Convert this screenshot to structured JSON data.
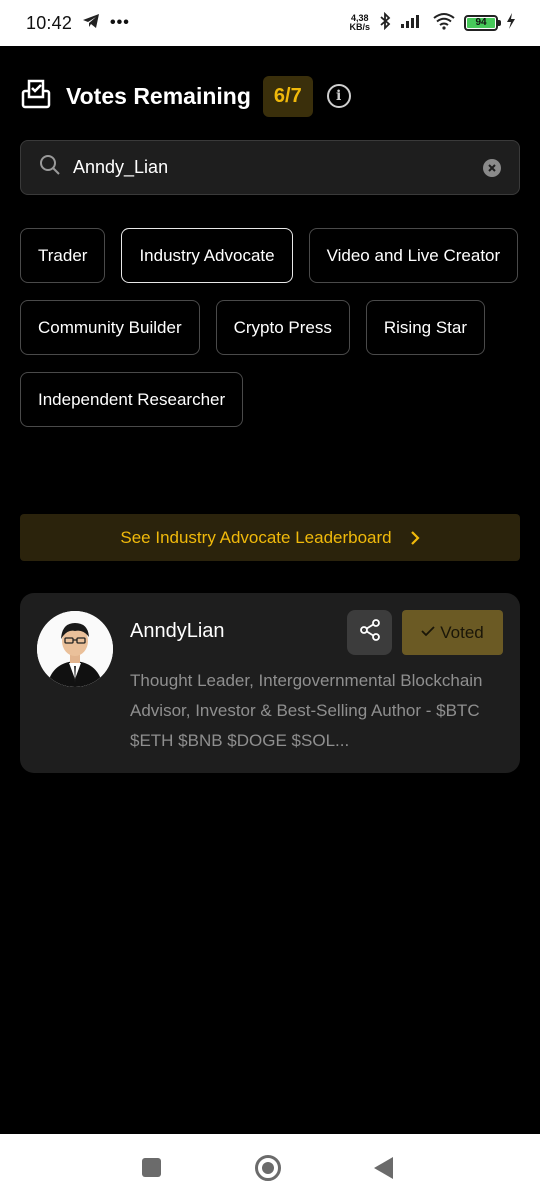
{
  "status_bar": {
    "time": "10:42",
    "network_speed_value": "4,38",
    "network_speed_unit": "KB/s",
    "battery": "94"
  },
  "header": {
    "title": "Votes Remaining",
    "votes_badge": "6/7"
  },
  "search": {
    "value": "Anndy_Lian"
  },
  "categories": [
    "Trader",
    "Industry Advocate",
    "Video and Live Creator",
    "Community Builder",
    "Crypto Press",
    "Rising Star",
    "Independent Researcher"
  ],
  "selected_category": "Industry Advocate",
  "leaderboard_link": "See Industry Advocate Leaderboard",
  "result_card": {
    "name": "AnndyLian",
    "voted_label": "Voted",
    "description": "Thought Leader, Intergovernmental Blockchain Advisor, Investor & Best-Selling Author - $BTC $ETH $BNB $DOGE $SOL..."
  },
  "colors": {
    "accent": "#f0b90b",
    "background": "#000000",
    "card": "#1e1e1e"
  }
}
